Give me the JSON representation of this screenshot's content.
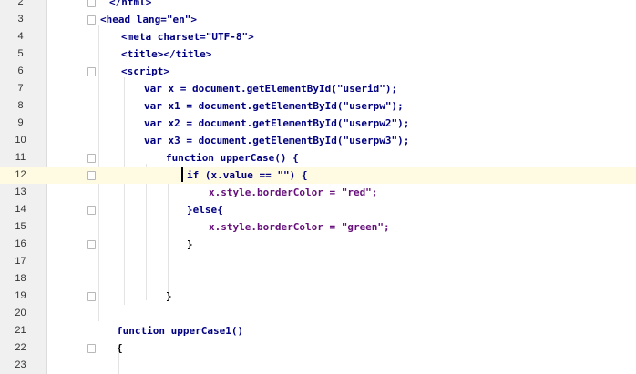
{
  "editor": {
    "current_line": 12,
    "lines": [
      {
        "num": "2",
        "text": "</html>"
      },
      {
        "num": "3",
        "text": "<head lang=\"en\">"
      },
      {
        "num": "4",
        "text": "<meta charset=\"UTF-8\">"
      },
      {
        "num": "5",
        "text": "<title></title>"
      },
      {
        "num": "6",
        "text": "<script>"
      },
      {
        "num": "7",
        "text": "var x = document.getElementById(\"userid\");"
      },
      {
        "num": "8",
        "text": "var x1 = document.getElementById(\"userpw\");"
      },
      {
        "num": "9",
        "text": "var x2 = document.getElementById(\"userpw2\");"
      },
      {
        "num": "10",
        "text": "var x3 = document.getElementById(\"userpw3\");"
      },
      {
        "num": "11",
        "text": "function upperCase() {"
      },
      {
        "num": "12",
        "text": "if (x.value == \"\") {"
      },
      {
        "num": "13",
        "text": "x.style.borderColor = \"red\";"
      },
      {
        "num": "14",
        "text": "}else{"
      },
      {
        "num": "15",
        "text": "x.style.borderColor = \"green\";"
      },
      {
        "num": "16",
        "text": "}"
      },
      {
        "num": "17",
        "text": ""
      },
      {
        "num": "18",
        "text": ""
      },
      {
        "num": "19",
        "text": "}"
      },
      {
        "num": "20",
        "text": ""
      },
      {
        "num": "21",
        "text": "function upperCase1()"
      },
      {
        "num": "22",
        "text": "{"
      },
      {
        "num": "23",
        "text": ""
      }
    ]
  },
  "colors": {
    "tag": "#000080",
    "attribute": "#0000ff",
    "string": "#008000",
    "keyword": "#000080",
    "variable": "#660e7a",
    "current_line": "#fffbe3",
    "gutter": "#f0f0f0"
  },
  "icons": {
    "fold_marker": "fold-marker-icon"
  }
}
